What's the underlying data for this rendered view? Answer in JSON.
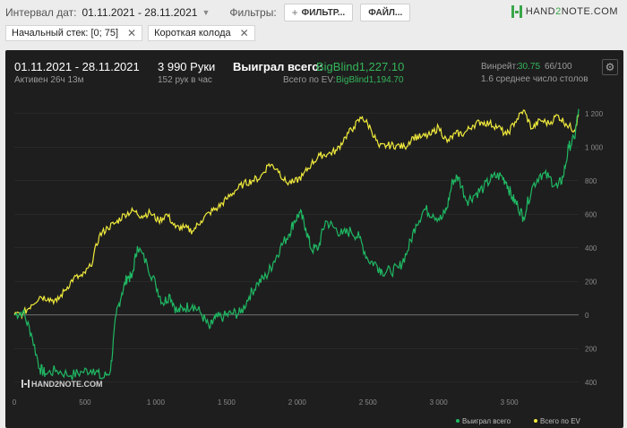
{
  "toolbar": {
    "date_label": "Интервал дат:",
    "date_value": "01.11.2021 - 28.11.2021",
    "filters_label": "Фильтры:",
    "filter_button": "ФИЛЬТР...",
    "file_button": "ФАЙЛ...",
    "logo": "HAND2NOTE.COM",
    "logo_text_a": "HAND",
    "logo_text_b": "2",
    "logo_text_c": "NOTE.COM"
  },
  "chips": [
    {
      "label": "Начальный стек: [0; 75]"
    },
    {
      "label": "Короткая колода"
    }
  ],
  "stats": {
    "period": "01.11.2021 - 28.11.2021",
    "active": "Активен 26ч 13м",
    "hands": "3 990 Руки",
    "hands_per_hour": "152 рук в час",
    "won_label": "Выиграл всего:",
    "won_value": "BigBlind1,227.10",
    "ev_label": "Всего по EV:",
    "ev_value": "BigBlind1,194.70",
    "winrate_label": "Винрейт:",
    "winrate_value": "30.75",
    "winrate_rest": "66/100",
    "tables": "1.6 среднее число столов"
  },
  "colors": {
    "won": "#1fb863",
    "ev": "#f0ea3c",
    "panel": "#1e1e1e"
  },
  "chart_data": {
    "type": "line",
    "xlim": [
      0,
      3990
    ],
    "ylim": [
      -430,
      1250
    ],
    "x_ticks": [
      0,
      500,
      1000,
      1500,
      2000,
      2500,
      3000,
      3500
    ],
    "x_tick_labels": [
      "0",
      "500",
      "1 000",
      "1 500",
      "2 000",
      "2 500",
      "3 000",
      "3 500"
    ],
    "y_ticks": [
      1200,
      1000,
      800,
      600,
      400,
      200,
      0,
      -200,
      -400
    ],
    "y_tick_labels": [
      "1 200",
      "1 000",
      "800",
      "600",
      "400",
      "200",
      "0",
      "200",
      "400"
    ],
    "watermark": "HAND2NOTE.COM",
    "series": [
      {
        "name": "Выиграл всего",
        "color": "#1fb863",
        "x": [
          0,
          60,
          120,
          180,
          220,
          300,
          400,
          480,
          560,
          620,
          680,
          720,
          760,
          800,
          830,
          870,
          940,
          1000,
          1050,
          1100,
          1150,
          1200,
          1260,
          1320,
          1380,
          1420,
          1480,
          1540,
          1600,
          1660,
          1720,
          1780,
          1830,
          1880,
          1940,
          1980,
          2020,
          2060,
          2100,
          2150,
          2200,
          2260,
          2320,
          2380,
          2440,
          2500,
          2560,
          2600,
          2660,
          2720,
          2780,
          2840,
          2900,
          2960,
          3020,
          3060,
          3100,
          3140,
          3200,
          3260,
          3320,
          3380,
          3440,
          3480,
          3520,
          3560,
          3600,
          3660,
          3720,
          3780,
          3840,
          3880,
          3920,
          3960,
          3990
        ],
        "values": [
          0,
          20,
          -110,
          -320,
          -350,
          -330,
          -360,
          -340,
          -320,
          -380,
          -330,
          0,
          130,
          230,
          220,
          410,
          300,
          180,
          70,
          120,
          20,
          40,
          60,
          10,
          -80,
          -20,
          -10,
          10,
          10,
          110,
          190,
          230,
          310,
          400,
          480,
          560,
          610,
          520,
          390,
          400,
          560,
          520,
          480,
          500,
          460,
          330,
          300,
          260,
          260,
          280,
          380,
          540,
          630,
          600,
          570,
          640,
          800,
          820,
          680,
          720,
          760,
          820,
          830,
          790,
          700,
          650,
          580,
          760,
          840,
          820,
          760,
          820,
          1000,
          1050,
          1227
        ]
      },
      {
        "name": "Всего по EV",
        "color": "#f0ea3c",
        "x": [
          0,
          60,
          120,
          180,
          240,
          300,
          360,
          420,
          480,
          540,
          600,
          660,
          720,
          780,
          840,
          900,
          960,
          1020,
          1080,
          1140,
          1200,
          1260,
          1320,
          1380,
          1440,
          1500,
          1560,
          1620,
          1680,
          1740,
          1800,
          1860,
          1920,
          1980,
          2040,
          2100,
          2160,
          2220,
          2280,
          2340,
          2400,
          2460,
          2520,
          2580,
          2640,
          2700,
          2760,
          2820,
          2880,
          2940,
          3000,
          3060,
          3120,
          3180,
          3240,
          3300,
          3360,
          3420,
          3480,
          3540,
          3600,
          3660,
          3720,
          3780,
          3840,
          3900,
          3960,
          3990
        ],
        "values": [
          0,
          5,
          60,
          110,
          100,
          80,
          150,
          220,
          230,
          290,
          470,
          520,
          550,
          600,
          620,
          590,
          610,
          560,
          600,
          520,
          520,
          500,
          560,
          610,
          640,
          690,
          740,
          780,
          800,
          820,
          900,
          870,
          790,
          790,
          830,
          900,
          950,
          960,
          980,
          1060,
          1120,
          1180,
          1110,
          1000,
          1010,
          1010,
          1000,
          1060,
          1060,
          1070,
          1120,
          1030,
          1080,
          1080,
          1130,
          1150,
          1140,
          1120,
          1070,
          1150,
          1220,
          1110,
          1160,
          1140,
          1190,
          1140,
          1100,
          1194.7
        ]
      }
    ]
  }
}
